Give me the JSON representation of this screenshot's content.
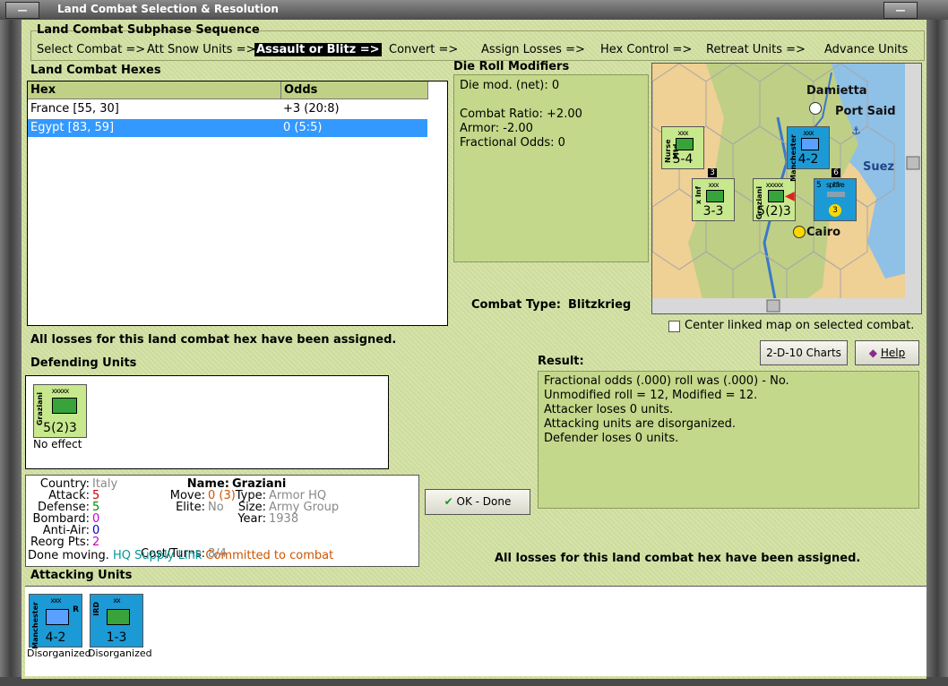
{
  "window": {
    "title": "Land Combat Selection & Resolution",
    "btn_left": "—",
    "btn_right": "—"
  },
  "sequence": {
    "title": "Land Combat Subphase Sequence",
    "steps": [
      "Select Combat =>",
      "Att Snow Units =>",
      "Assault or Blitz =>",
      "Convert =>",
      "Assign Losses =>",
      "Hex Control =>",
      "Retreat Units =>",
      "Advance Units"
    ],
    "active_index": 2
  },
  "hexes": {
    "title": "Land Combat Hexes",
    "columns": [
      "Hex",
      "Odds"
    ],
    "rows": [
      {
        "hex": "France [55, 30]",
        "odds": "+3 (20:8)"
      },
      {
        "hex": "Egypt [83, 59]",
        "odds": "0 (5:5)"
      }
    ],
    "selected_row": 1
  },
  "dice": {
    "title": "Die Roll Modifiers",
    "lines": [
      "Die mod. (net): 0",
      "",
      "Combat Ratio: +2.00",
      "Armor: -2.00",
      "Fractional Odds: 0"
    ]
  },
  "map": {
    "labels": {
      "damietta": "Damietta",
      "port_said": "Port Said",
      "suez": "Suez",
      "cairo": "Cairo"
    },
    "counters": {
      "a": {
        "top": "xxx",
        "side": "Nurse Mtd",
        "val": "5-4"
      },
      "b": {
        "top": "xxx",
        "side": "x Inf",
        "val": "3-3"
      },
      "c": {
        "top": "xxxxx",
        "side": "Graziani",
        "val": "5(2)3"
      },
      "d": {
        "top": "xxx",
        "side": "Manchester",
        "val": "4-2"
      },
      "e": {
        "top": "spitfire",
        "side": "5",
        "val": "3"
      }
    },
    "stack_numbers": {
      "n1": "3",
      "n2": "6"
    },
    "center_checkbox_label": "Center linked map on selected combat.",
    "center_checked": false
  },
  "combat_type": {
    "label": "Combat Type:",
    "value": "Blitzkrieg"
  },
  "losses_msg_top": "All losses for this land combat hex have been assigned.",
  "defending": {
    "title": "Defending Units",
    "unit": {
      "top": "xxxxx",
      "side": "Graziani",
      "val": "5(2)3",
      "status": "No effect"
    }
  },
  "unit_info": {
    "country_lbl": "Country:",
    "country": "Italy",
    "attack_lbl": "Attack:",
    "attack": "5",
    "defense_lbl": "Defense:",
    "defense": "5",
    "bombard_lbl": "Bombard:",
    "bombard": "0",
    "antiair_lbl": "Anti-Air:",
    "antiair": "0",
    "reorg_lbl": "Reorg Pts:",
    "reorg": "2",
    "name_lbl": "Name:",
    "name": "Graziani",
    "move_lbl": "Move:",
    "move": "0 (3)",
    "type_lbl": "Type:",
    "type": "Armor HQ",
    "elite_lbl": "Elite:",
    "elite": "No",
    "size_lbl": "Size:",
    "size": "Army Group",
    "year_lbl": "Year:",
    "year": "1938",
    "cost_lbl": "Cost/Turns:",
    "cost": "8/4",
    "done_moving": "Done moving.",
    "hq_supply": "HQ Supply Link",
    "committed": "Committed to combat",
    "colors": {
      "red": "#cc0000",
      "green": "#008800",
      "blue": "#0000cc",
      "magenta": "#cc00cc",
      "orange": "#cc5500",
      "grey": "#888888",
      "teal": "#009999"
    }
  },
  "buttons": {
    "charts": "2-D-10 Charts",
    "help": "Help",
    "ok": "OK - Done"
  },
  "result": {
    "title": "Result:",
    "lines": [
      "Fractional odds (.000) roll was (.000)  - No.",
      "Unmodified roll = 12, Modified = 12.",
      "Attacker loses 0 units.",
      "Attacking units are disorganized.",
      "Defender loses 0 units."
    ]
  },
  "losses_msg_bottom": "All losses for this land combat hex have been assigned.",
  "attacking": {
    "title": "Attacking Units",
    "units": [
      {
        "top": "xxx",
        "side": "Manchester",
        "corner": "R",
        "val": "4-2",
        "status": "Disorganized"
      },
      {
        "top": "xx",
        "side": "IRD",
        "corner": "",
        "val": "1-3",
        "status": "Disorganized"
      }
    ]
  }
}
